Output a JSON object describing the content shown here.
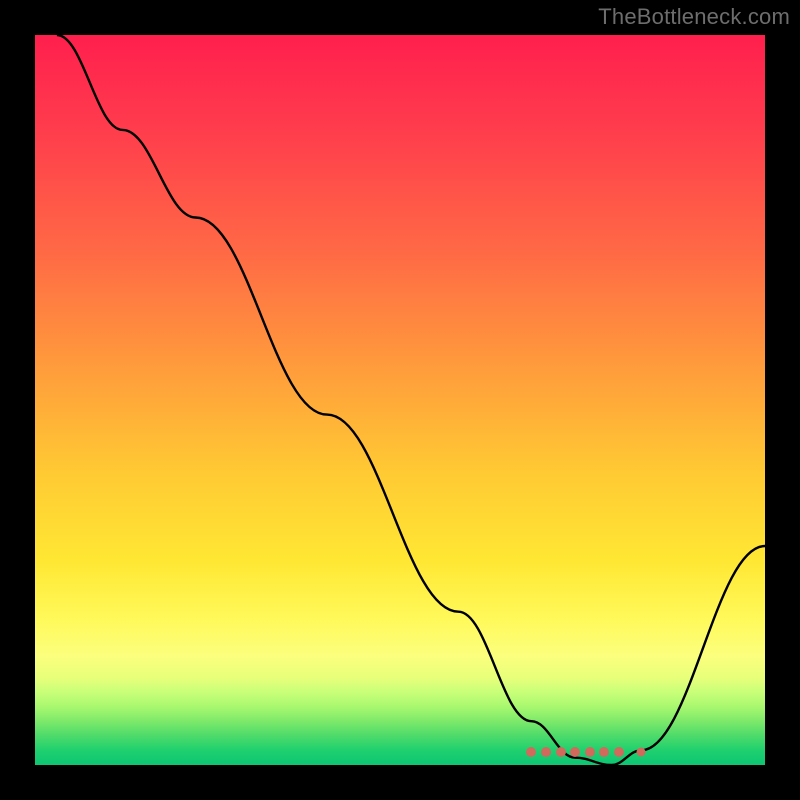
{
  "attribution": "TheBottleneck.com",
  "chart_data": {
    "type": "line",
    "title": "",
    "xlabel": "",
    "ylabel": "",
    "xlim": [
      0,
      100
    ],
    "ylim": [
      0,
      100
    ],
    "grid": false,
    "legend": false,
    "series": [
      {
        "name": "bottleneck-curve",
        "x": [
          3,
          12,
          22,
          40,
          58,
          68,
          74,
          79,
          83,
          100
        ],
        "y": [
          100,
          87,
          75,
          48,
          21,
          6,
          1,
          0,
          2,
          30
        ],
        "color": "#000000"
      }
    ],
    "markers": {
      "name": "optimal-cluster",
      "color": "#cf6a5d",
      "x": [
        68,
        70,
        72,
        74,
        76,
        78,
        80,
        83
      ],
      "y": [
        1.8,
        1.8,
        1.8,
        1.8,
        1.8,
        1.8,
        1.8,
        1.8
      ]
    },
    "background_gradient": {
      "stops": [
        {
          "pct": 0,
          "color": "#ff1f4d"
        },
        {
          "pct": 30,
          "color": "#ff6a45"
        },
        {
          "pct": 60,
          "color": "#ffca33"
        },
        {
          "pct": 85,
          "color": "#fcff7d"
        },
        {
          "pct": 100,
          "color": "#0dc673"
        }
      ]
    }
  }
}
